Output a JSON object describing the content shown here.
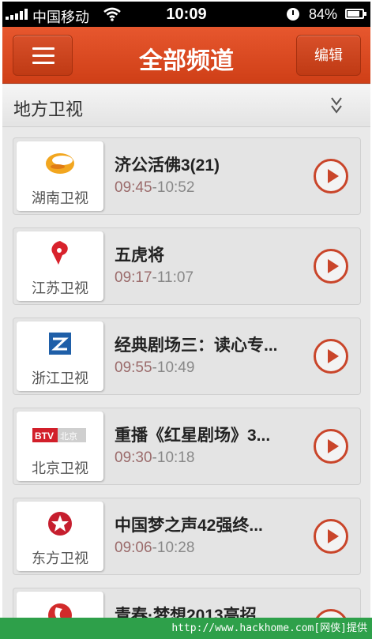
{
  "status_bar": {
    "carrier": "中国移动",
    "time": "10:09",
    "battery_pct": "84%",
    "icons": [
      "signal-icon",
      "wifi-icon",
      "alarm-clock-icon",
      "battery-icon"
    ]
  },
  "nav": {
    "menu_icon": "hamburger-menu-icon",
    "title": "全部频道",
    "edit_label": "编辑",
    "accent_color": "#d9502a"
  },
  "category": {
    "label": "地方卫视",
    "toggle_icon": "double-chevron-down-icon"
  },
  "channels": [
    {
      "name": "湖南卫视",
      "logo": "hunan-tv-logo",
      "program": "济公活佛3(21)",
      "start": "09:45",
      "end": "-10:52"
    },
    {
      "name": "江苏卫视",
      "logo": "jiangsu-tv-logo",
      "program": "五虎将",
      "start": "09:17",
      "end": "-11:07"
    },
    {
      "name": "浙江卫视",
      "logo": "zhejiang-tv-logo",
      "program": "经典剧场三：读心专...",
      "start": "09:55",
      "end": "-10:49"
    },
    {
      "name": "北京卫视",
      "logo": "beijing-tv-logo",
      "logo_text": "BTV北京",
      "program": "重播《红星剧场》3...",
      "start": "09:30",
      "end": "-10:18"
    },
    {
      "name": "东方卫视",
      "logo": "dragon-tv-logo",
      "program": "中国梦之声42强终...",
      "start": "09:06",
      "end": "-10:28"
    },
    {
      "name": "",
      "logo": "anhui-tv-logo",
      "program": "青春·梦想2013高招...",
      "start": "",
      "end": ""
    }
  ],
  "watermark": "http://www.hackhome.com[网侠]提供"
}
